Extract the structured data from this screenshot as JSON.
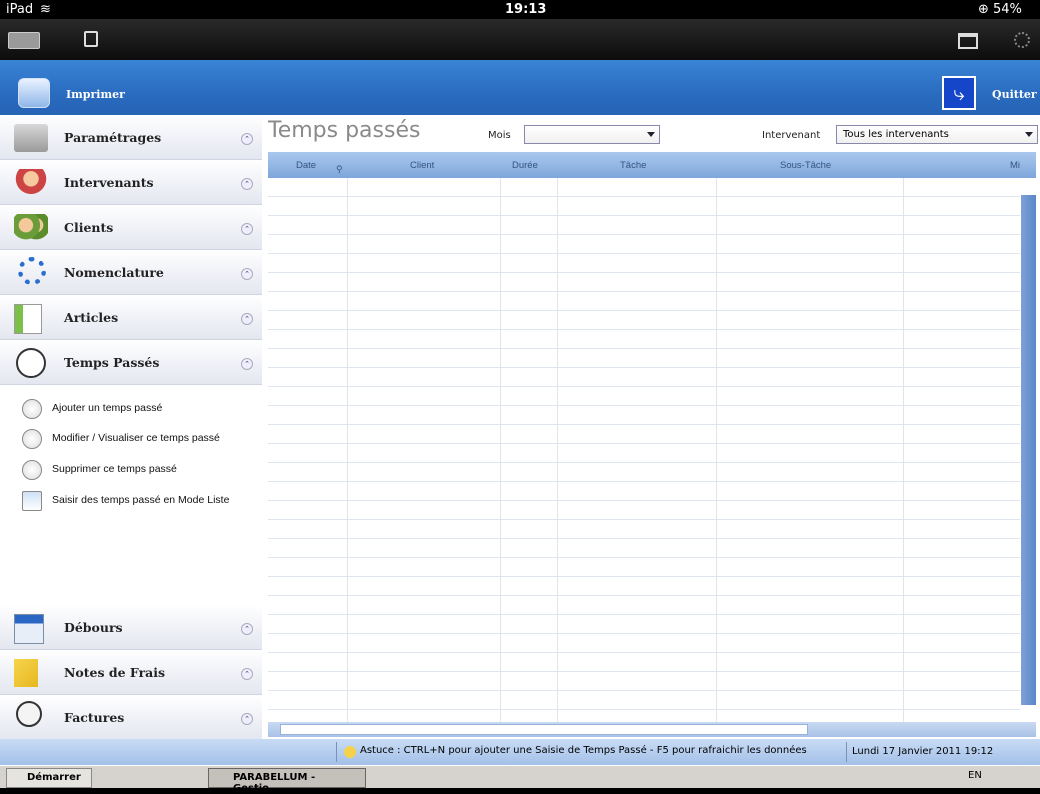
{
  "ios": {
    "device": "iPad",
    "time": "19:13",
    "battery": "54%"
  },
  "toolbar": {
    "print_label": "Imprimer",
    "quit_label": "Quitter"
  },
  "sidebar": {
    "items": [
      {
        "label": "Paramétrages",
        "icon": "settings-folder-icon"
      },
      {
        "label": "Intervenants",
        "icon": "person-icon"
      },
      {
        "label": "Clients",
        "icon": "people-icon"
      },
      {
        "label": "Nomenclature",
        "icon": "gear-icon"
      },
      {
        "label": "Articles",
        "icon": "article-icon"
      },
      {
        "label": "Temps Passés",
        "icon": "clock-icon"
      }
    ],
    "sub_items": [
      {
        "label": "Ajouter un temps passé"
      },
      {
        "label": "Modifier / Visualiser ce temps passé"
      },
      {
        "label": "Supprimer ce temps passé"
      },
      {
        "label": "Saisir des temps passé en Mode Liste"
      }
    ],
    "bottom_items": [
      {
        "label": "Débours",
        "icon": "calculator-icon"
      },
      {
        "label": "Notes de Frais",
        "icon": "note-icon"
      },
      {
        "label": "Factures",
        "icon": "invoice-icon"
      }
    ]
  },
  "main": {
    "title": "Temps passés",
    "mois_label": "Mois",
    "mois_value": "",
    "intervenant_label": "Intervenant",
    "intervenant_value": "Tous les intervenants",
    "columns": [
      "Date",
      "Client",
      "Durée",
      "Tâche",
      "Sous-Tâche",
      "Mi"
    ]
  },
  "status": {
    "tip": "Astuce : CTRL+N pour ajouter une Saisie de Temps Passé - F5 pour rafraichir les données",
    "date": "Lundi 17 Janvier 2011 19:12"
  },
  "taskbar": {
    "start": "Démarrer",
    "app": "PARABELLUM - Gestio...",
    "lang": "EN"
  }
}
